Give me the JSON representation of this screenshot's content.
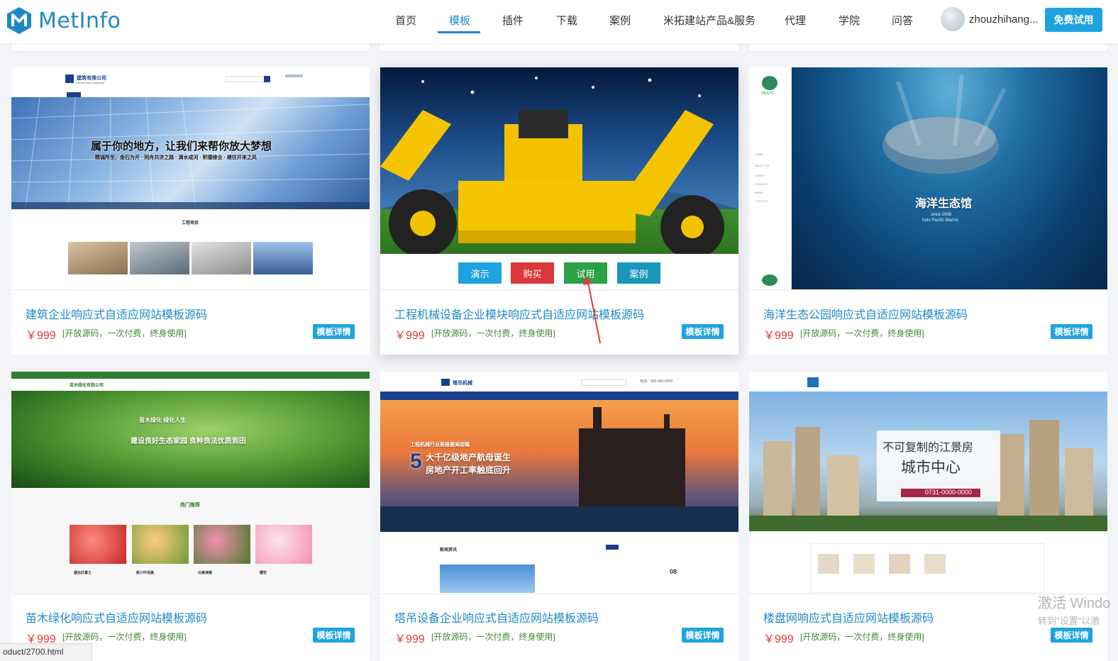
{
  "header": {
    "logo_text": "MetInfo",
    "nav": [
      "首页",
      "模板",
      "插件",
      "下载",
      "案例",
      "米拓建站产品&服务",
      "代理",
      "学院",
      "问答"
    ],
    "active_nav": "模板",
    "username": "zhouzhihang...",
    "trial_label": "免费试用"
  },
  "cards": [
    {
      "title": "建筑企业响应式自适应网站模板源码",
      "price": "￥999",
      "note": "[开放源码，一次付费，终身使用]",
      "detail": "模板详情",
      "thumb": {
        "company": "建筑有限公司",
        "company_en": "construction company",
        "phone": "400000000",
        "slogan": "属于你的地方，让我们来帮你放大梦想",
        "subslogan": "精诚所至，金石为开 · 同舟共济之路 · 滴水成河 · 积德修业 · 继往开来之风",
        "section": "工程项目"
      }
    },
    {
      "title": "工程机械设备企业模块响应式自适应网站模板源码",
      "price": "￥999",
      "note": "[开放源码，一次付费，终身使用]",
      "detail": "模板详情",
      "actions": [
        "演示",
        "购买",
        "试用",
        "案例"
      ]
    },
    {
      "title": "海洋生态公园响应式自适应网站模板源码",
      "price": "￥999",
      "note": "[开放源码，一次付费，终身使用]",
      "detail": "模板详情",
      "thumb": {
        "brand": "OESTIC",
        "menu": [
          "HOME",
          "ABOUT US",
          "CASES",
          "PRODUCT",
          "NEWS",
          "CONTACT"
        ],
        "banner_title": "海洋生态馆",
        "since": "since 2008",
        "marine": "Indo Pacific Marine"
      }
    },
    {
      "title": "苗木绿化响应式自适应网站模板源码",
      "price": "￥999",
      "note": "[开放源码，一次付费，终身使用]",
      "detail": "模板详情",
      "thumb": {
        "company": "苗木绿化有限公司",
        "banner1": "苗木绿化 绿化人生",
        "banner2": "建设良好生态家园  良种良法优质到田",
        "section": "热门推荐",
        "items": [
          "烟台红富士",
          "新川中岛桃",
          "北美海棠",
          "樱花"
        ]
      }
    },
    {
      "title": "塔吊设备企业响应式自适应网站模板源码",
      "price": "￥999",
      "note": "[开放源码，一次付费，终身使用]",
      "detail": "模板详情",
      "thumb": {
        "company": "塔吊机械",
        "phone": "电话：000-000-0000",
        "headline_small": "工程机械行业周报要闻前瞻",
        "big_number": "5",
        "headline1": "大千亿级地产航母诞生",
        "headline2": "房地产开工率触底回升",
        "news": "新闻资讯",
        "date": "08"
      }
    },
    {
      "title": "楼盘网响应式自适应网站模板源码",
      "price": "￥999",
      "note": "[开放源码，一次付费，终身使用]",
      "detail": "模板详情",
      "thumb": {
        "line1": "不可复制的江景房",
        "line2": "城市中心",
        "phone": "0731-0000-0000"
      }
    }
  ],
  "status_url": "oduct/2700.html",
  "watermark": {
    "line1": "激活 Windo",
    "line2": "转到\"设置\"以激"
  },
  "colors": {
    "accent": "#1e88c7",
    "button_blue": "#1fa3e0",
    "price_red": "#e53935",
    "note_green": "#3c8d2f",
    "act_demo": "#1fa3e0",
    "act_buy": "#d9383a",
    "act_trial": "#2ba245",
    "act_case": "#1997b8"
  }
}
